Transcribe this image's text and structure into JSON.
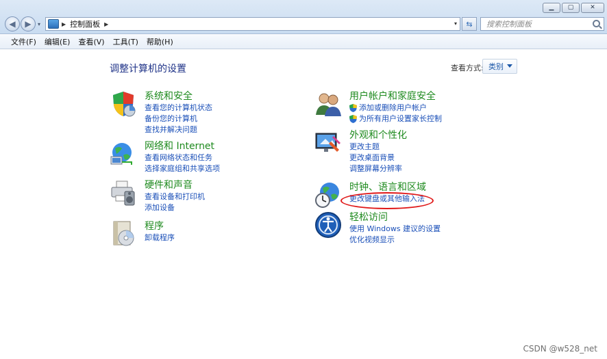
{
  "window": {
    "minimize_glyph": "▁",
    "maximize_glyph": "▢",
    "close_glyph": "✕"
  },
  "nav": {
    "back_glyph": "◀",
    "forward_glyph": "▶",
    "dropdown_glyph": "▾"
  },
  "address": {
    "breadcrumb_sep": "▶",
    "location": "控制面板",
    "trail_sep": "▶",
    "dropdown_glyph": "▾"
  },
  "refresh_glyph": "⇆",
  "search": {
    "placeholder": "搜索控制面板"
  },
  "menu": [
    "文件(F)",
    "编辑(E)",
    "查看(V)",
    "工具(T)",
    "帮助(H)"
  ],
  "page": {
    "title": "调整计算机的设置",
    "viewby_label": "查看方式:",
    "viewby_value": "类别"
  },
  "categories": [
    {
      "title": "系统和安全",
      "icon": "shield-chart-icon",
      "links": [
        "查看您的计算机状态",
        "备份您的计算机",
        "查找并解决问题"
      ]
    },
    {
      "title": "网络和 Internet",
      "icon": "network-globe-icon",
      "links": [
        "查看网络状态和任务",
        "选择家庭组和共享选项"
      ]
    },
    {
      "title": "硬件和声音",
      "icon": "printer-speaker-icon",
      "links": [
        "查看设备和打印机",
        "添加设备"
      ]
    },
    {
      "title": "程序",
      "icon": "programs-disc-icon",
      "links": [
        "卸载程序"
      ]
    },
    {
      "title": "用户帐户和家庭安全",
      "icon": "users-icon",
      "links": [
        "添加或删除用户帐户",
        "为所有用户设置家长控制"
      ]
    },
    {
      "title": "外观和个性化",
      "icon": "display-palette-icon",
      "links": [
        "更改主题",
        "更改桌面背景",
        "调整屏幕分辨率"
      ]
    },
    {
      "title": "时钟、语言和区域",
      "icon": "clock-globe-icon",
      "links": [
        "更改键盘或其他输入法"
      ]
    },
    {
      "title": "轻松访问",
      "icon": "ease-of-access-icon",
      "links": [
        "使用 Windows 建议的设置",
        "优化视频显示"
      ]
    }
  ],
  "watermark": "CSDN @w528_net",
  "colors": {
    "category_title": "#1e8a1e",
    "link": "#1a4fb8",
    "page_title": "#1e3287",
    "annotation": "#e01818"
  }
}
